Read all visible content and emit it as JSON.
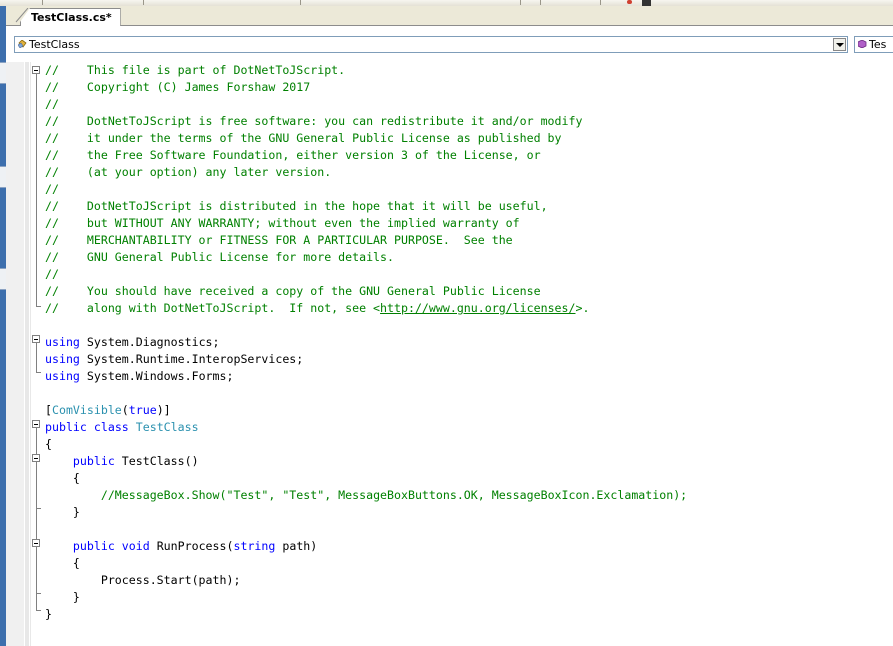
{
  "document": {
    "tab_title": "TestClass.cs*",
    "class_dropdown_value": "TestClass",
    "member_dropdown_value": "Tes"
  },
  "code_lines": [
    [
      [
        "c",
        "//    This file is part of DotNetToJScript."
      ]
    ],
    [
      [
        "c",
        "//    Copyright (C) James Forshaw 2017"
      ]
    ],
    [
      [
        "c",
        "//"
      ]
    ],
    [
      [
        "c",
        "//    DotNetToJScript is free software: you can redistribute it and/or modify"
      ]
    ],
    [
      [
        "c",
        "//    it under the terms of the GNU General Public License as published by"
      ]
    ],
    [
      [
        "c",
        "//    the Free Software Foundation, either version 3 of the License, or"
      ]
    ],
    [
      [
        "c",
        "//    (at your option) any later version."
      ]
    ],
    [
      [
        "c",
        "//"
      ]
    ],
    [
      [
        "c",
        "//    DotNetToJScript is distributed in the hope that it will be useful,"
      ]
    ],
    [
      [
        "c",
        "//    but WITHOUT ANY WARRANTY; without even the implied warranty of"
      ]
    ],
    [
      [
        "c",
        "//    MERCHANTABILITY or FITNESS FOR A PARTICULAR PURPOSE.  See the"
      ]
    ],
    [
      [
        "c",
        "//    GNU General Public License for more details."
      ]
    ],
    [
      [
        "c",
        "//"
      ]
    ],
    [
      [
        "c",
        "//    You should have received a copy of the GNU General Public License"
      ]
    ],
    [
      [
        "c",
        "//    along with DotNetToJScript.  If not, see <"
      ],
      [
        "u",
        "http://www.gnu.org/licenses/"
      ],
      [
        "c",
        ">."
      ]
    ],
    [],
    [
      [
        "k",
        "using"
      ],
      [
        "p",
        " System.Diagnostics;"
      ]
    ],
    [
      [
        "k",
        "using"
      ],
      [
        "p",
        " System.Runtime.InteropServices;"
      ]
    ],
    [
      [
        "k",
        "using"
      ],
      [
        "p",
        " System.Windows.Forms;"
      ]
    ],
    [],
    [
      [
        "p",
        "["
      ],
      [
        "t",
        "ComVisible"
      ],
      [
        "p",
        "("
      ],
      [
        "k",
        "true"
      ],
      [
        "p",
        ")]"
      ]
    ],
    [
      [
        "k",
        "public"
      ],
      [
        "p",
        " "
      ],
      [
        "k",
        "class"
      ],
      [
        "p",
        " "
      ],
      [
        "t",
        "TestClass"
      ]
    ],
    [
      [
        "p",
        "{"
      ]
    ],
    [
      [
        "p",
        "    "
      ],
      [
        "k",
        "public"
      ],
      [
        "p",
        " TestClass()"
      ]
    ],
    [
      [
        "p",
        "    {"
      ]
    ],
    [
      [
        "p",
        "        "
      ],
      [
        "c",
        "//MessageBox.Show(\"Test\", \"Test\", MessageBoxButtons.OK, MessageBoxIcon.Exclamation);"
      ]
    ],
    [
      [
        "p",
        "    }"
      ]
    ],
    [],
    [
      [
        "p",
        "    "
      ],
      [
        "k",
        "public"
      ],
      [
        "p",
        " "
      ],
      [
        "k",
        "void"
      ],
      [
        "p",
        " RunProcess("
      ],
      [
        "k",
        "string"
      ],
      [
        "p",
        " path)"
      ]
    ],
    [
      [
        "p",
        "    {"
      ]
    ],
    [
      [
        "p",
        "        Process.Start(path);"
      ]
    ],
    [
      [
        "p",
        "    }"
      ]
    ],
    [
      [
        "p",
        "}"
      ]
    ]
  ],
  "colors": {
    "comment": "#008000",
    "keyword": "#0000ff",
    "type": "#2b91af",
    "text": "#000000"
  },
  "icons": {
    "class_dropdown": "class-icon",
    "member_dropdown": "method-icon"
  }
}
